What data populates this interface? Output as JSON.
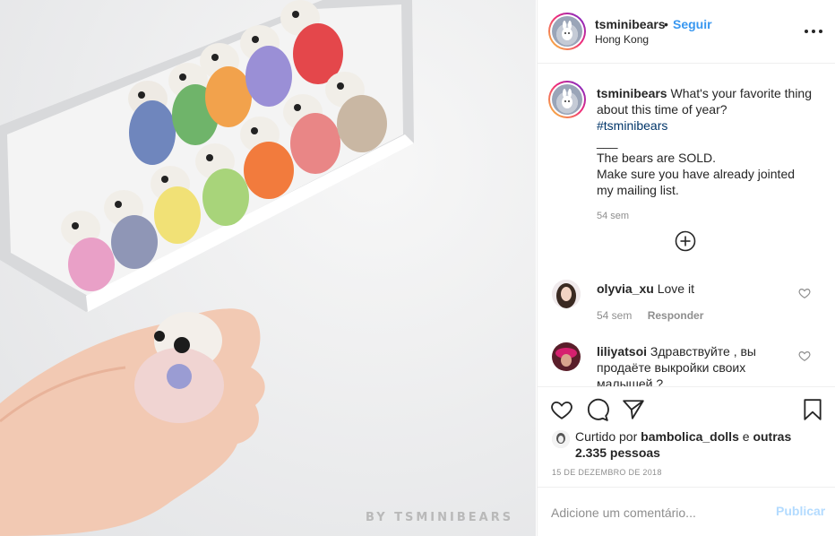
{
  "photo": {
    "alt_icon": "photo-of-mini-bears",
    "watermark": "BY TSMINIBEARS"
  },
  "header": {
    "username": "tsminibears",
    "separator": "•",
    "follow_label": "Seguir",
    "location": "Hong Kong",
    "more_icon": "more-options-icon"
  },
  "caption": {
    "username": "tsminibears",
    "text": "What's your favorite thing about this time of year?",
    "hashtag": "#tsminibears",
    "divider": "___",
    "line1": "The bears are SOLD.",
    "line2": "Make sure you have already jointed",
    "line3": "my mailing list.",
    "time": "54 sem",
    "load_more_icon": "plus-circle-icon"
  },
  "comments": [
    {
      "username": "olyvia_xu",
      "text": "Love it",
      "time": "54 sem",
      "reply_label": "Responder"
    },
    {
      "username": "liliyatsoi",
      "text": "Здравствуйте , вы продаёте выкройки своих малышей ?"
    }
  ],
  "actions": {
    "like_icon": "heart-icon",
    "comment_icon": "comment-icon",
    "share_icon": "share-icon",
    "save_icon": "bookmark-icon"
  },
  "likes": {
    "prefix": "Curtido por",
    "username": "bambolica_dolls",
    "conjunction": "e",
    "others": "outras 2.335 pessoas"
  },
  "date": "15 DE DEZEMBRO DE 2018",
  "add_comment": {
    "placeholder": "Adicione um comentário...",
    "post_label": "Publicar"
  },
  "colors": {
    "accent": "#3897f0",
    "post_disabled": "#b3dbff",
    "hashtag": "#003569",
    "muted": "#8e8e8e"
  }
}
